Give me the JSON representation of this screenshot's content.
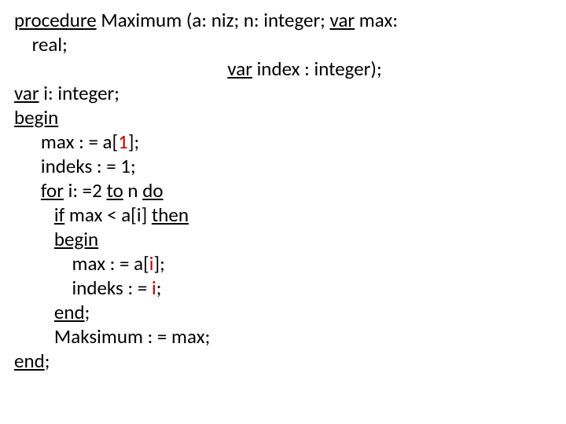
{
  "code": {
    "kw_procedure": "procedure",
    "header_rest": " Maximum (a: niz; n: integer; ",
    "kw_var1": "var",
    "header_tail": " max: ",
    "line2": "    real;",
    "line3_pre": "                                                ",
    "kw_var2": "var",
    "line3_post": " index : integer);",
    "kw_var3": "var",
    "line4_post": " i: integer;",
    "kw_begin1": "begin",
    "line6_pre": "      max : = a[",
    "one": "1",
    "line6_post": "];",
    "line7": "      indeks : = 1;",
    "line8_pre": "      ",
    "kw_for": "for",
    "line8_mid": " i: =2 ",
    "kw_to": "to",
    "line8_mid2": " n ",
    "kw_do": "do",
    "line9_pre": "         ",
    "kw_if": "if",
    "line9_mid": " max < a[i] ",
    "kw_then": "then",
    "line10_pre": "         ",
    "kw_begin2": "begin",
    "line11_pre": "             max : = a[",
    "i1": "i",
    "line11_post": "];",
    "line12_pre": "             indeks : = ",
    "i2": "i",
    "line12_post": ";",
    "line13_pre": "         ",
    "kw_end1": "end",
    "line13_post": ";",
    "line14": "         Maksimum : = max;",
    "kw_end2": "end",
    "line15_post": ";"
  }
}
